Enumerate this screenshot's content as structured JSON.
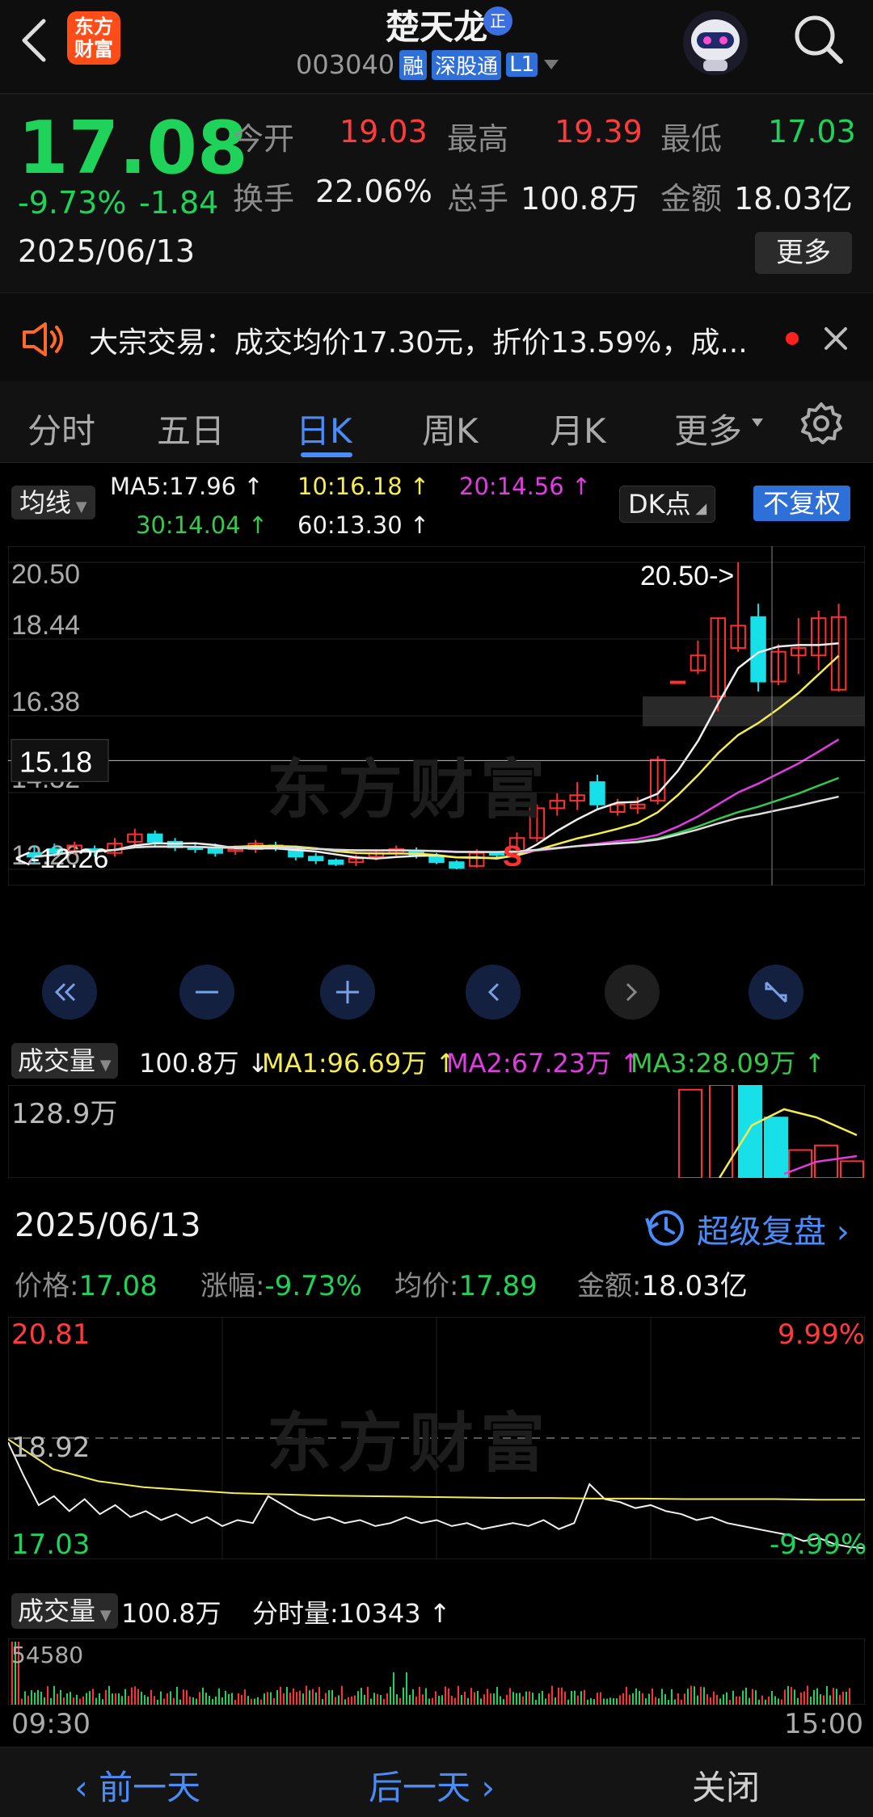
{
  "header": {
    "back_icon": "chevron-left-icon",
    "logo_line1": "东方",
    "logo_line2": "财富",
    "stock_name": "楚天龙",
    "name_badge": "正",
    "stock_code": "003040",
    "badge_rong": "融",
    "badge_sgt": "深股通",
    "badge_l1": "L1",
    "dropdown_icon": "triangle-down-icon",
    "robot_icon": "robot-avatar-icon",
    "search_icon": "search-icon"
  },
  "quote": {
    "price": "17.08",
    "change_pct": "-9.73%",
    "change_abs": "-1.84",
    "date": "2025/06/13",
    "open_label": "今开",
    "open_value": "19.03",
    "high_label": "最高",
    "high_value": "19.39",
    "low_label": "最低",
    "low_value": "17.03",
    "turnover_label": "换手",
    "turnover_value": "22.06%",
    "volume_label": "总手",
    "volume_value": "100.8万",
    "amount_label": "金额",
    "amount_value": "18.03亿",
    "more_label": "更多"
  },
  "notice": {
    "speaker_icon": "speaker-icon",
    "text": "大宗交易：成交均价17.30元，折价13.59%，成...",
    "close_icon": "close-icon"
  },
  "tabs": [
    {
      "label": "分时"
    },
    {
      "label": "五日"
    },
    {
      "label": "日K"
    },
    {
      "label": "周K"
    },
    {
      "label": "月K"
    },
    {
      "label": "更多"
    }
  ],
  "tabs_gear_icon": "gear-icon",
  "kline": {
    "ma_selector": "均线",
    "ma5": "MA5:17.96",
    "ma10": "10:16.18",
    "ma20": "20:14.56",
    "ma30": "30:14.04",
    "ma60": "60:13.30",
    "dk_label": "DK点",
    "fq_label": "不复权",
    "y_labels": [
      "20.50",
      "18.44",
      "16.38",
      "14.32",
      "12.26"
    ],
    "max_marker": "20.50->",
    "min_marker": "<-12.26",
    "crosshair_value": "15.18",
    "sell_marker": "S",
    "watermark": "东方财富",
    "vol_selector": "成交量",
    "vol_value": "100.8万",
    "vol_ma1": "MA1:96.69万",
    "vol_ma2": "MA2:67.23万",
    "vol_ma3": "MA3:28.09万",
    "vol_max": "128.9万"
  },
  "day": {
    "date": "2025/06/13",
    "replay_label": "超级复盘",
    "replay_icon": "history-clock-icon",
    "price_label": "价格:",
    "price_value": "17.08",
    "chg_label": "涨幅:",
    "chg_value": "-9.73%",
    "avg_label": "均价:",
    "avg_value": "17.89",
    "amt_label": "金额:",
    "amt_value": "18.03亿",
    "y_top": "20.81",
    "y_mid": "18.92",
    "y_bottom": "17.03",
    "pct_top": "9.99%",
    "pct_bottom": "-9.99%",
    "watermark": "东方财富",
    "vol_selector": "成交量",
    "vol_value": "100.8万",
    "tick_vol": "分时量:10343",
    "vol_max": "54580",
    "time_start": "09:30",
    "time_end": "15:00"
  },
  "footer": {
    "prev_label": "前一天",
    "next_label": "后一天",
    "close_label": "关闭"
  },
  "chart_data": [
    {
      "type": "candlestick",
      "title": "",
      "ylim": [
        12.26,
        20.5
      ],
      "y_ticks": [
        20.5,
        18.44,
        16.38,
        14.32,
        12.26
      ],
      "candles": [
        {
          "o": 12.7,
          "c": 12.6,
          "h": 12.9,
          "l": 12.4
        },
        {
          "o": 12.8,
          "c": 12.7,
          "h": 12.95,
          "l": 12.6
        },
        {
          "o": 12.75,
          "c": 12.9,
          "h": 13.0,
          "l": 12.65
        },
        {
          "o": 12.8,
          "c": 12.75,
          "h": 12.9,
          "l": 12.6
        },
        {
          "o": 12.7,
          "c": 12.95,
          "h": 13.1,
          "l": 12.6
        },
        {
          "o": 13.0,
          "c": 13.2,
          "h": 13.35,
          "l": 12.9
        },
        {
          "o": 13.2,
          "c": 13.0,
          "h": 13.3,
          "l": 12.9
        },
        {
          "o": 13.0,
          "c": 12.85,
          "h": 13.1,
          "l": 12.75
        },
        {
          "o": 12.85,
          "c": 12.8,
          "h": 12.95,
          "l": 12.7
        },
        {
          "o": 12.85,
          "c": 12.7,
          "h": 12.95,
          "l": 12.6
        },
        {
          "o": 12.75,
          "c": 12.8,
          "h": 12.9,
          "l": 12.65
        },
        {
          "o": 12.8,
          "c": 12.95,
          "h": 13.05,
          "l": 12.7
        },
        {
          "o": 12.9,
          "c": 12.85,
          "h": 13.0,
          "l": 12.75
        },
        {
          "o": 12.85,
          "c": 12.6,
          "h": 12.9,
          "l": 12.5
        },
        {
          "o": 12.6,
          "c": 12.5,
          "h": 12.7,
          "l": 12.4
        },
        {
          "o": 12.5,
          "c": 12.4,
          "h": 12.55,
          "l": 12.35
        },
        {
          "o": 12.45,
          "c": 12.55,
          "h": 12.65,
          "l": 12.35
        },
        {
          "o": 12.6,
          "c": 12.7,
          "h": 12.8,
          "l": 12.5
        },
        {
          "o": 12.7,
          "c": 12.8,
          "h": 12.9,
          "l": 12.6
        },
        {
          "o": 12.75,
          "c": 12.65,
          "h": 12.85,
          "l": 12.55
        },
        {
          "o": 12.6,
          "c": 12.45,
          "h": 12.7,
          "l": 12.4
        },
        {
          "o": 12.45,
          "c": 12.3,
          "h": 12.5,
          "l": 12.26
        },
        {
          "o": 12.35,
          "c": 12.7,
          "h": 12.8,
          "l": 12.3
        },
        {
          "o": 12.7,
          "c": 12.65,
          "h": 12.75,
          "l": 12.55
        },
        {
          "o": 12.7,
          "c": 13.1,
          "h": 13.25,
          "l": 12.6
        },
        {
          "o": 13.1,
          "c": 13.9,
          "h": 14.0,
          "l": 13.0
        },
        {
          "o": 13.9,
          "c": 14.1,
          "h": 14.3,
          "l": 13.7
        },
        {
          "o": 14.1,
          "c": 14.25,
          "h": 14.6,
          "l": 13.85
        },
        {
          "o": 14.6,
          "c": 14.0,
          "h": 14.8,
          "l": 13.85
        },
        {
          "o": 13.8,
          "c": 14.0,
          "h": 14.15,
          "l": 13.7
        },
        {
          "o": 13.9,
          "c": 14.0,
          "h": 14.2,
          "l": 13.75
        },
        {
          "o": 14.1,
          "c": 15.2,
          "h": 15.3,
          "l": 14.0
        },
        {
          "o": 17.3,
          "c": 17.3,
          "h": 17.3,
          "l": 17.3
        },
        {
          "o": 17.6,
          "c": 18.0,
          "h": 18.4,
          "l": 17.5
        },
        {
          "o": 16.9,
          "c": 19.0,
          "h": 19.0,
          "l": 16.5
        },
        {
          "o": 18.2,
          "c": 18.8,
          "h": 20.5,
          "l": 18.1
        },
        {
          "o": 19.03,
          "c": 17.3,
          "h": 19.39,
          "l": 17.03
        },
        {
          "o": 17.3,
          "c": 18.1,
          "h": 18.3,
          "l": 17.2
        },
        {
          "o": 18.0,
          "c": 18.2,
          "h": 19.0,
          "l": 17.5
        },
        {
          "o": 18.0,
          "c": 19.0,
          "h": 19.2,
          "l": 17.6
        },
        {
          "o": 17.08,
          "c": 19.03,
          "h": 19.39,
          "l": 17.03
        }
      ],
      "moving_averages": [
        {
          "name": "MA5",
          "value": 17.96
        },
        {
          "name": "MA10",
          "value": 16.18
        },
        {
          "name": "MA20",
          "value": 14.56
        },
        {
          "name": "MA30",
          "value": 14.04
        },
        {
          "name": "MA60",
          "value": 13.3
        }
      ],
      "max_value": 20.5,
      "min_value": 12.26,
      "crosshair": 15.18
    },
    {
      "type": "line",
      "title": "",
      "ylim": [
        17.03,
        20.81
      ],
      "x_labels": [
        "09:30",
        "15:00"
      ],
      "series": [
        {
          "name": "价格",
          "values": [
            18.85,
            18.3,
            17.8,
            17.95,
            17.7,
            17.9,
            17.65,
            17.8,
            17.6,
            17.7,
            17.55,
            17.65,
            17.5,
            17.6,
            17.45,
            17.55,
            17.5,
            17.95,
            17.8,
            17.65,
            17.55,
            17.6,
            17.5,
            17.55,
            17.45,
            17.5,
            17.6,
            17.5,
            17.55,
            17.45,
            17.5,
            17.4,
            17.45,
            17.5,
            17.45,
            17.55,
            17.4,
            17.5,
            18.15,
            17.9,
            17.85,
            17.75,
            17.8,
            17.7,
            17.65,
            17.55,
            17.6,
            17.5,
            17.45,
            17.4,
            17.35,
            17.3,
            17.2,
            17.25,
            17.15,
            17.1,
            17.08
          ]
        },
        {
          "name": "均价",
          "values": [
            18.9,
            18.4,
            18.2,
            18.1,
            18.05,
            18.0,
            17.98,
            17.96,
            17.95,
            17.94,
            17.93,
            17.92,
            17.92,
            17.91,
            17.91,
            17.9,
            17.9,
            17.9,
            17.89,
            17.89
          ]
        }
      ],
      "ref_line": 18.92,
      "pct_top": "9.99%",
      "pct_bottom": "-9.99%"
    }
  ]
}
